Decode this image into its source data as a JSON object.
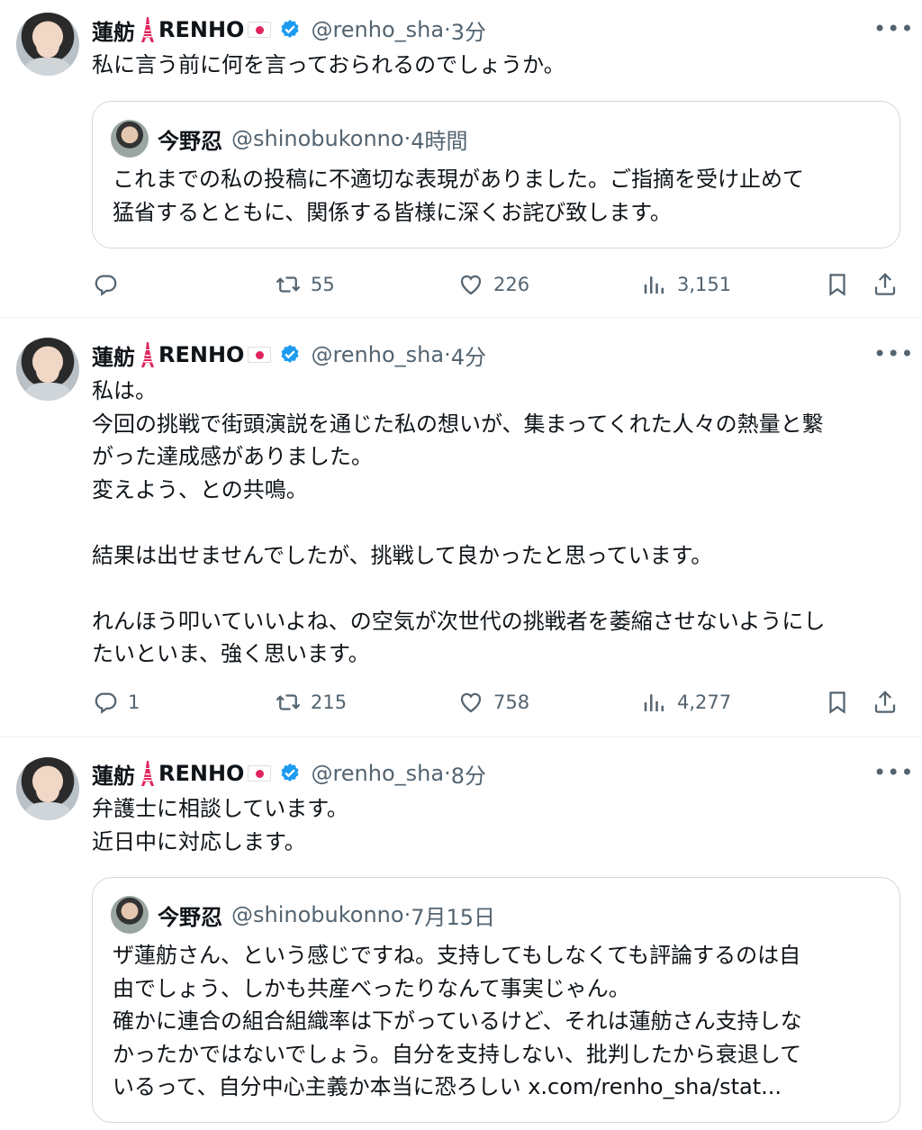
{
  "tweets": [
    {
      "author": "蓮舫",
      "author_suffix": "RENHO",
      "handle": "@renho_sha",
      "sep": " · ",
      "time": "3分",
      "more": "•••",
      "text": "私に言う前に何を言っておられるのでしょうか。",
      "quote": {
        "author": "今野忍",
        "handle": "@shinobukonno",
        "sep": " · ",
        "time": "4時間",
        "text": "これまでの私の投稿に不適切な表現がありました。ご指摘を受け止めて\n猛省するとともに、関係する皆様に深くお詫び致します。"
      },
      "replies": "",
      "reposts": "55",
      "likes": "226",
      "views": "3,151"
    },
    {
      "author": "蓮舫",
      "author_suffix": "RENHO",
      "handle": "@renho_sha",
      "sep": " · ",
      "time": "4分",
      "more": "•••",
      "text": "私は。\n今回の挑戦で街頭演説を通じた私の想いが、集まってくれた人々の熱量と繋\nがった達成感がありました。\n変えよう、との共鳴。\n\n結果は出せませんでしたが、挑戦して良かったと思っています。\n\nれんほう叩いていいよね、の空気が次世代の挑戦者を萎縮させないようにし\nたいといま、強く思います。",
      "replies": "1",
      "reposts": "215",
      "likes": "758",
      "views": "4,277"
    },
    {
      "author": "蓮舫",
      "author_suffix": "RENHO",
      "handle": "@renho_sha",
      "sep": " · ",
      "time": "8分",
      "more": "•••",
      "text": "弁護士に相談しています。\n近日中に対応します。",
      "quote": {
        "author": "今野忍",
        "handle": "@shinobukonno",
        "sep": " · ",
        "time": "7月15日",
        "text": "ザ蓮舫さん、という感じですね。支持してもしなくても評論するのは自\n由でしょう、しかも共産べったりなんて事実じゃん。\n確かに連合の組合組織率は下がっているけど、それは蓮舫さん支持しな\nかったかではないでしょう。自分を支持しない、批判したから衰退して\nいるって、自分中心主義か本当に恐ろしい x.com/renho_sha/stat..."
      }
    }
  ],
  "icons": {
    "reply": "reply-icon",
    "repost": "repost-icon",
    "like": "heart-icon",
    "views": "views-icon",
    "bookmark": "bookmark-icon",
    "share": "share-icon",
    "verified": "verified-badge-icon",
    "tower": "tokyo-tower-icon",
    "flag": "japan-flag-icon"
  },
  "colors": {
    "verified": "#1d9bf0",
    "secondary": "#536471",
    "text": "#0f1419",
    "border": "#cfd9de"
  }
}
